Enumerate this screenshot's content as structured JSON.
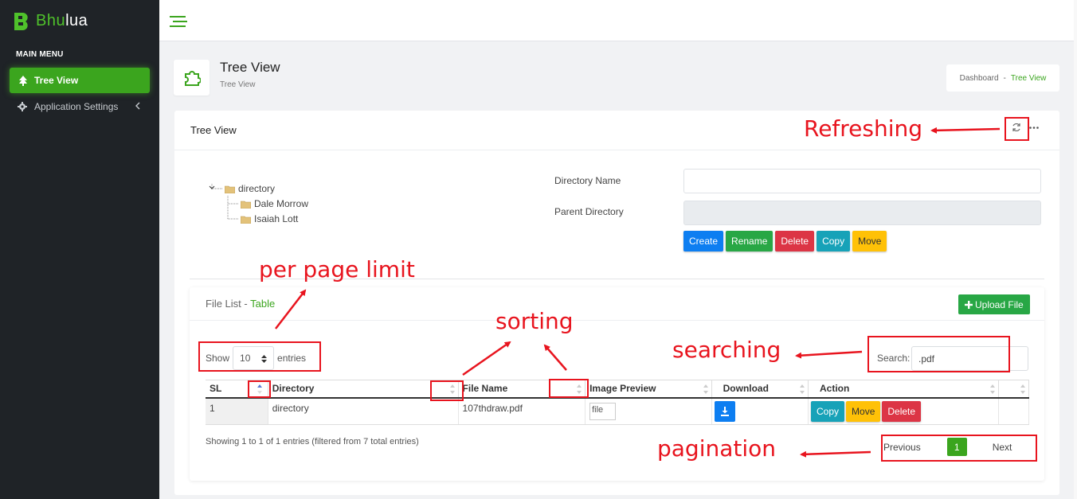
{
  "app": {
    "brand_a": "Bhu",
    "brand_b": "lua"
  },
  "sidebar": {
    "menu_heading": "MAIN MENU",
    "items": [
      {
        "label": "Tree View",
        "icon": "tree-icon",
        "active": true
      },
      {
        "label": "Application Settings",
        "icon": "gear-icon",
        "active": false
      }
    ]
  },
  "page_header": {
    "title": "Tree View",
    "subtitle": "Tree View"
  },
  "breadcrumb": {
    "root": "Dashboard",
    "separator": "-",
    "current": "Tree View"
  },
  "card": {
    "title": "Tree View"
  },
  "tree": {
    "root": "directory",
    "children": [
      "Dale Morrow",
      "Isaiah Lott"
    ]
  },
  "form": {
    "directory_name_label": "Directory Name",
    "parent_directory_label": "Parent Directory",
    "directory_name_value": "",
    "parent_directory_value": "",
    "buttons": [
      "Create",
      "Rename",
      "Delete",
      "Copy",
      "Move"
    ]
  },
  "file_list": {
    "title": "File List",
    "separator": "-",
    "title_highlight": "Table",
    "upload_label": "Upload File",
    "show_label": "Show",
    "entries_label": "entries",
    "per_page": "10",
    "search_label": "Search:",
    "search_value": ".pdf",
    "columns": [
      "SL",
      "Directory",
      "File Name",
      "Image Preview",
      "Download",
      "Action",
      ""
    ],
    "rows": [
      {
        "sl": "1",
        "directory": "directory",
        "file_name": "107thdraw.pdf",
        "image_alt": "file",
        "actions": [
          "Copy",
          "Move",
          "Delete"
        ]
      }
    ],
    "info": "Showing 1 to 1 of 1 entries (filtered from 7 total entries)",
    "pagination": {
      "previous": "Previous",
      "current": "1",
      "next": "Next"
    }
  },
  "annotations": {
    "refreshing": "Refreshing",
    "per_page_limit": "per page limit",
    "sorting": "sorting",
    "searching": "searching",
    "pagination": "pagination"
  },
  "colors": {
    "accent": "#3ba51e",
    "sidebar_bg": "#1f2327",
    "annotation": "#e8141e"
  }
}
